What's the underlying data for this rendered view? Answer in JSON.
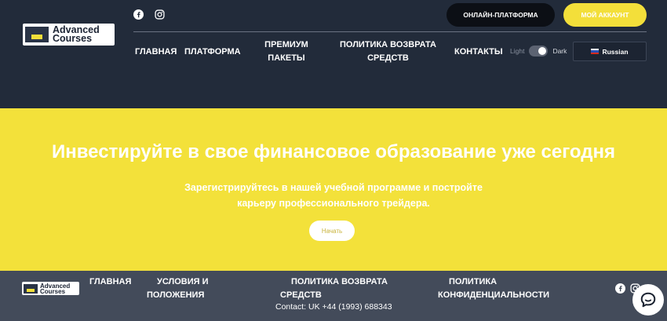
{
  "brand": {
    "logo_line1": "Advanced",
    "logo_line2": "Courses"
  },
  "header": {
    "social": [
      "facebook-icon",
      "instagram-icon"
    ],
    "platform_button": "ОНЛАЙН-ПЛАТФОРМА",
    "account_button": "МОЙ АККАУНТ",
    "nav": {
      "home": "ГЛАВНАЯ",
      "platform": "ПЛАТФОРМА",
      "premium_1": "ПРЕМИУМ",
      "premium_2": "ПАКЕТЫ",
      "refund_1": "ПОЛИТИКА ВОЗВРАТА",
      "refund_2": "СРЕДСТВ",
      "contacts": "КОНТАКТЫ"
    },
    "theme_light": "Light",
    "theme_dark": "Dark",
    "language": "Russian"
  },
  "hero": {
    "title": "Инвестируйте в свое финансовое образование уже сегодня",
    "subtitle_1": "Зарегистрируйтесь в нашей учебной программе и постройте",
    "subtitle_2": "карьеру профессионального трейдера.",
    "start_button": "Начать"
  },
  "footer": {
    "nav": {
      "home": "ГЛАВНАЯ",
      "terms_1": "УСЛОВИЯ И",
      "terms_2": "ПОЛОЖЕНИЯ",
      "refund_1": "ПОЛИТИКА ВОЗВРАТА",
      "refund_2": "СРЕДСТВ",
      "privacy_1": "ПОЛИТИКА",
      "privacy_2": "КОНФИДЕНЦИАЛЬНОСТИ"
    },
    "contact": "Contact: UK +44 (1993) 688343"
  },
  "colors": {
    "header_bg": "#222b3a",
    "accent_yellow": "#f3e13a",
    "footer_bg": "#434b5a",
    "dark_button": "#0c0f15"
  }
}
